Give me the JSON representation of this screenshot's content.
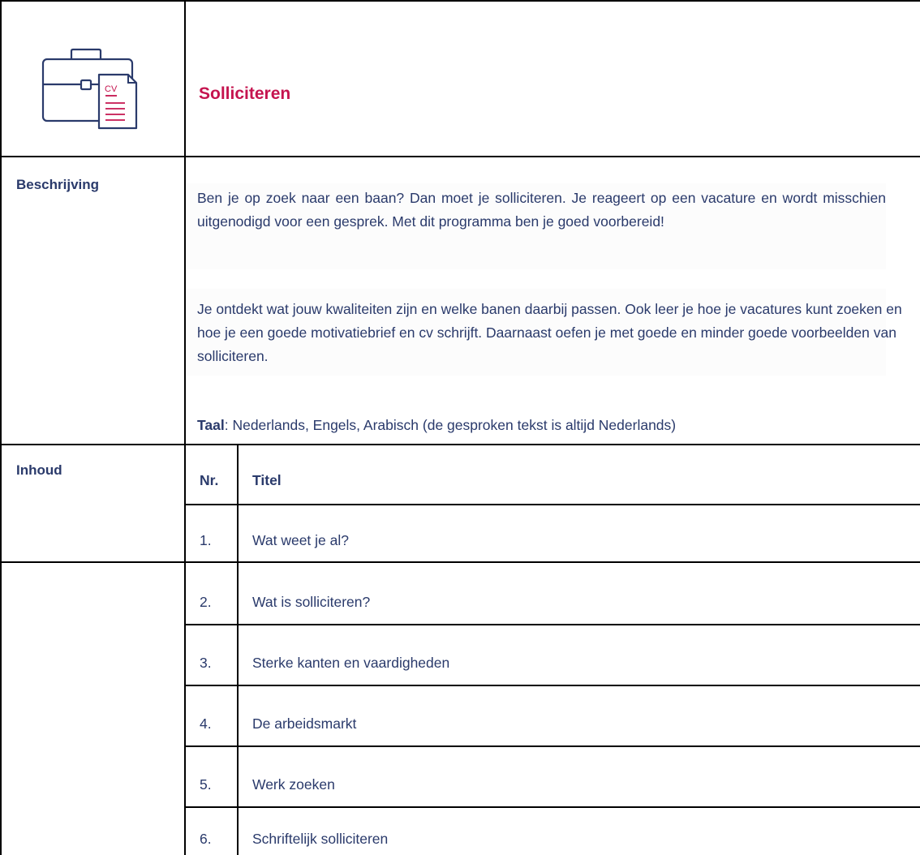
{
  "header": {
    "icon": "briefcase-cv-icon",
    "icon_badge": "CV",
    "title": "Solliciteren"
  },
  "description": {
    "label": "Beschrijving",
    "paragraphs": [
      "Ben je op zoek naar een baan? Dan moet je solliciteren. Je reageert op een vacature en wordt misschien uitgenodigd voor een gesprek. Met dit programma ben je goed voorbereid!",
      "Je ontdekt wat jouw kwaliteiten zijn en welke banen daarbij passen. Ook leer je hoe je vacatures kunt zoeken en hoe je een goede motivatiebrief en cv schrijft. Daarnaast oefen je met goede en minder goede voorbeelden van solliciteren."
    ],
    "language_label": "Taal",
    "language_value": ": Nederlands, Engels, Arabisch (de gesproken tekst is altijd Nederlands)"
  },
  "contents": {
    "label": "Inhoud",
    "columns": [
      "Nr.",
      "Titel"
    ],
    "rows": [
      {
        "nr": "1.",
        "title": "Wat weet je al?"
      },
      {
        "nr": "2.",
        "title": "Wat is solliciteren?"
      },
      {
        "nr": "3.",
        "title": "Sterke kanten en vaardigheden"
      },
      {
        "nr": "4.",
        "title": "De arbeidsmarkt"
      },
      {
        "nr": "5.",
        "title": "Werk zoeken"
      },
      {
        "nr": "6.",
        "title": "Schriftelijk solliciteren"
      }
    ]
  },
  "colors": {
    "title": "#c5144f",
    "text": "#2a3a6b",
    "border": "#000000"
  }
}
